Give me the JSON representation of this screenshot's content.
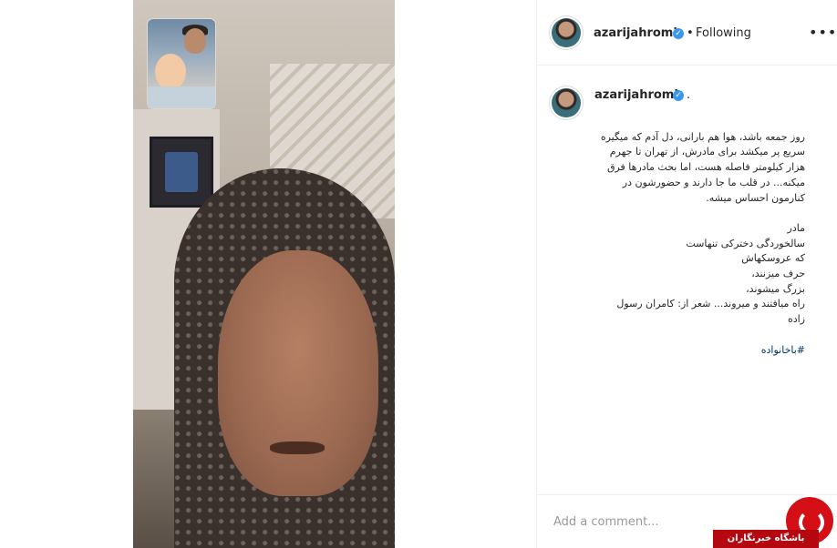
{
  "post": {
    "author": "azarijahromi",
    "follow_sep": "•",
    "follow_label": "Following",
    "more_label": "•••",
    "caption_author": "azarijahromi",
    "caption_dot": ".",
    "caption_text": "روز جمعه باشد، هوا هم بارانی، دل آدم که میگیره سریع پر میکشد برای مادرش، از تهران تا جهرم هزار کیلومتر فاصله هست، اما بحث مادرها فرق میکنه... در قلب ما جا دارند و حضورشون در کنارمون احساس میشه.\n\nمادر\nسالخوردگی دخترکی تنهاست\nکه عروسکهاش\nحرف میزنند،\nبزرگ میشوند،\nراه میافتند و میروند... شعر از: کامران رسول زاده",
    "hashtag": "#باخانواده",
    "comment_placeholder": "Add a comment..."
  },
  "icons": {
    "verified": "verified-badge-icon",
    "more": "more-options-icon"
  },
  "watermark": {
    "label": "باشگاه خبرنگاران"
  },
  "colors": {
    "verified": "#3897f0",
    "hashtag": "#003569",
    "watermark": "#d40f16"
  }
}
